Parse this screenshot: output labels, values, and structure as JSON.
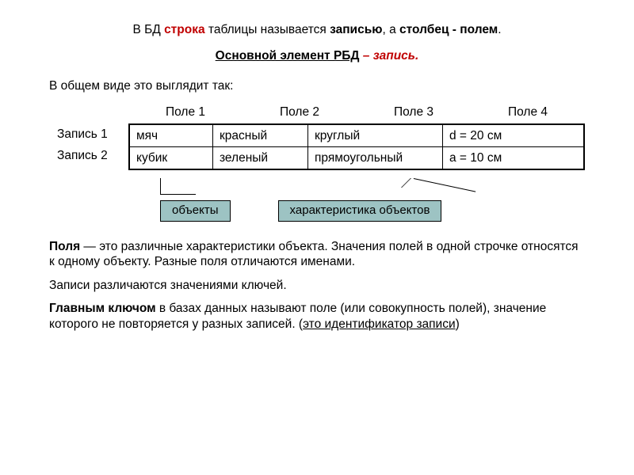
{
  "title": {
    "pre": "В БД ",
    "row_word": "строка",
    "mid1": " таблицы называется ",
    "record_word": "записью",
    "mid2": ", а ",
    "col_word": "столбец - полем",
    "end": "."
  },
  "subtitle": {
    "prefix": "Основной элемент РБД",
    "dash": " – ",
    "word": "запись",
    "suffix": "."
  },
  "intro": "В общем виде это выглядит так:",
  "headers": {
    "h1": "Поле 1",
    "h2": "Поле 2",
    "h3": "Поле 3",
    "h4": "Поле 4"
  },
  "rowlabels": {
    "r1": "Запись 1",
    "r2": "Запись 2"
  },
  "rows": [
    {
      "c1": "мяч",
      "c2": "красный",
      "c3": "круглый",
      "c4": "d = 20 см"
    },
    {
      "c1": "кубик",
      "c2": "зеленый",
      "c3": "прямоугольный",
      "c4": "a = 10 см"
    }
  ],
  "tags": {
    "objects": "объекты",
    "chars": "характеристика объектов"
  },
  "fields_def": {
    "term": "Поля",
    "rest": " — это различные характеристики объекта. Значения полей в одной строчке относятся к одному объекту. Разные поля отличаются именами."
  },
  "records_diff": "Записи различаются значениями ключей.",
  "mainkey": {
    "term": "Главным ключом",
    "mid": " в базах данных называют поле (или совокупность полей), значение которого не повторяется у разных записей. (",
    "underlined": "это идентификатор записи",
    "end": ")"
  }
}
